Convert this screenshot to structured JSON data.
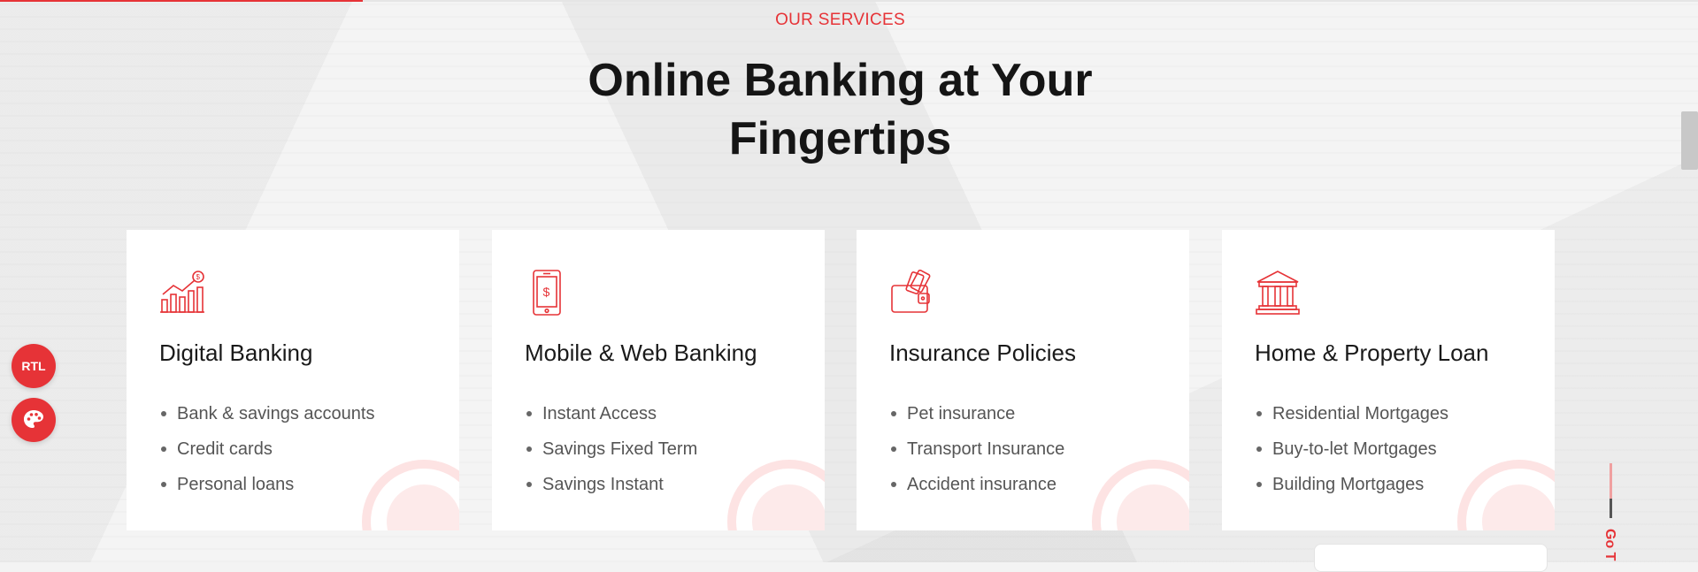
{
  "section": {
    "eyebrow": "OUR SERVICES",
    "heading_line1": "Online Banking at Your",
    "heading_line2": "Fingertips"
  },
  "cards": [
    {
      "icon": "growth-chart-icon",
      "title": "Digital Banking",
      "items": [
        "Bank & savings accounts",
        "Credit cards",
        "Personal loans"
      ]
    },
    {
      "icon": "mobile-dollar-icon",
      "title": "Mobile & Web Banking",
      "items": [
        "Instant Access",
        "Savings Fixed Term",
        "Savings Instant"
      ]
    },
    {
      "icon": "wallet-card-icon",
      "title": "Insurance Policies",
      "items": [
        "Pet insurance",
        "Transport Insurance",
        "Accident insurance"
      ]
    },
    {
      "icon": "bank-building-icon",
      "title": "Home & Property Loan",
      "items": [
        "Residential Mortgages",
        "Buy-to-let Mortgages",
        "Building Mortgages"
      ]
    }
  ],
  "side": {
    "rtl_label": "RTL",
    "palette_icon": "palette-icon"
  },
  "go_top": {
    "label": "Go T"
  },
  "colors": {
    "accent": "#e63337",
    "text": "#151515",
    "muted": "#555555"
  }
}
